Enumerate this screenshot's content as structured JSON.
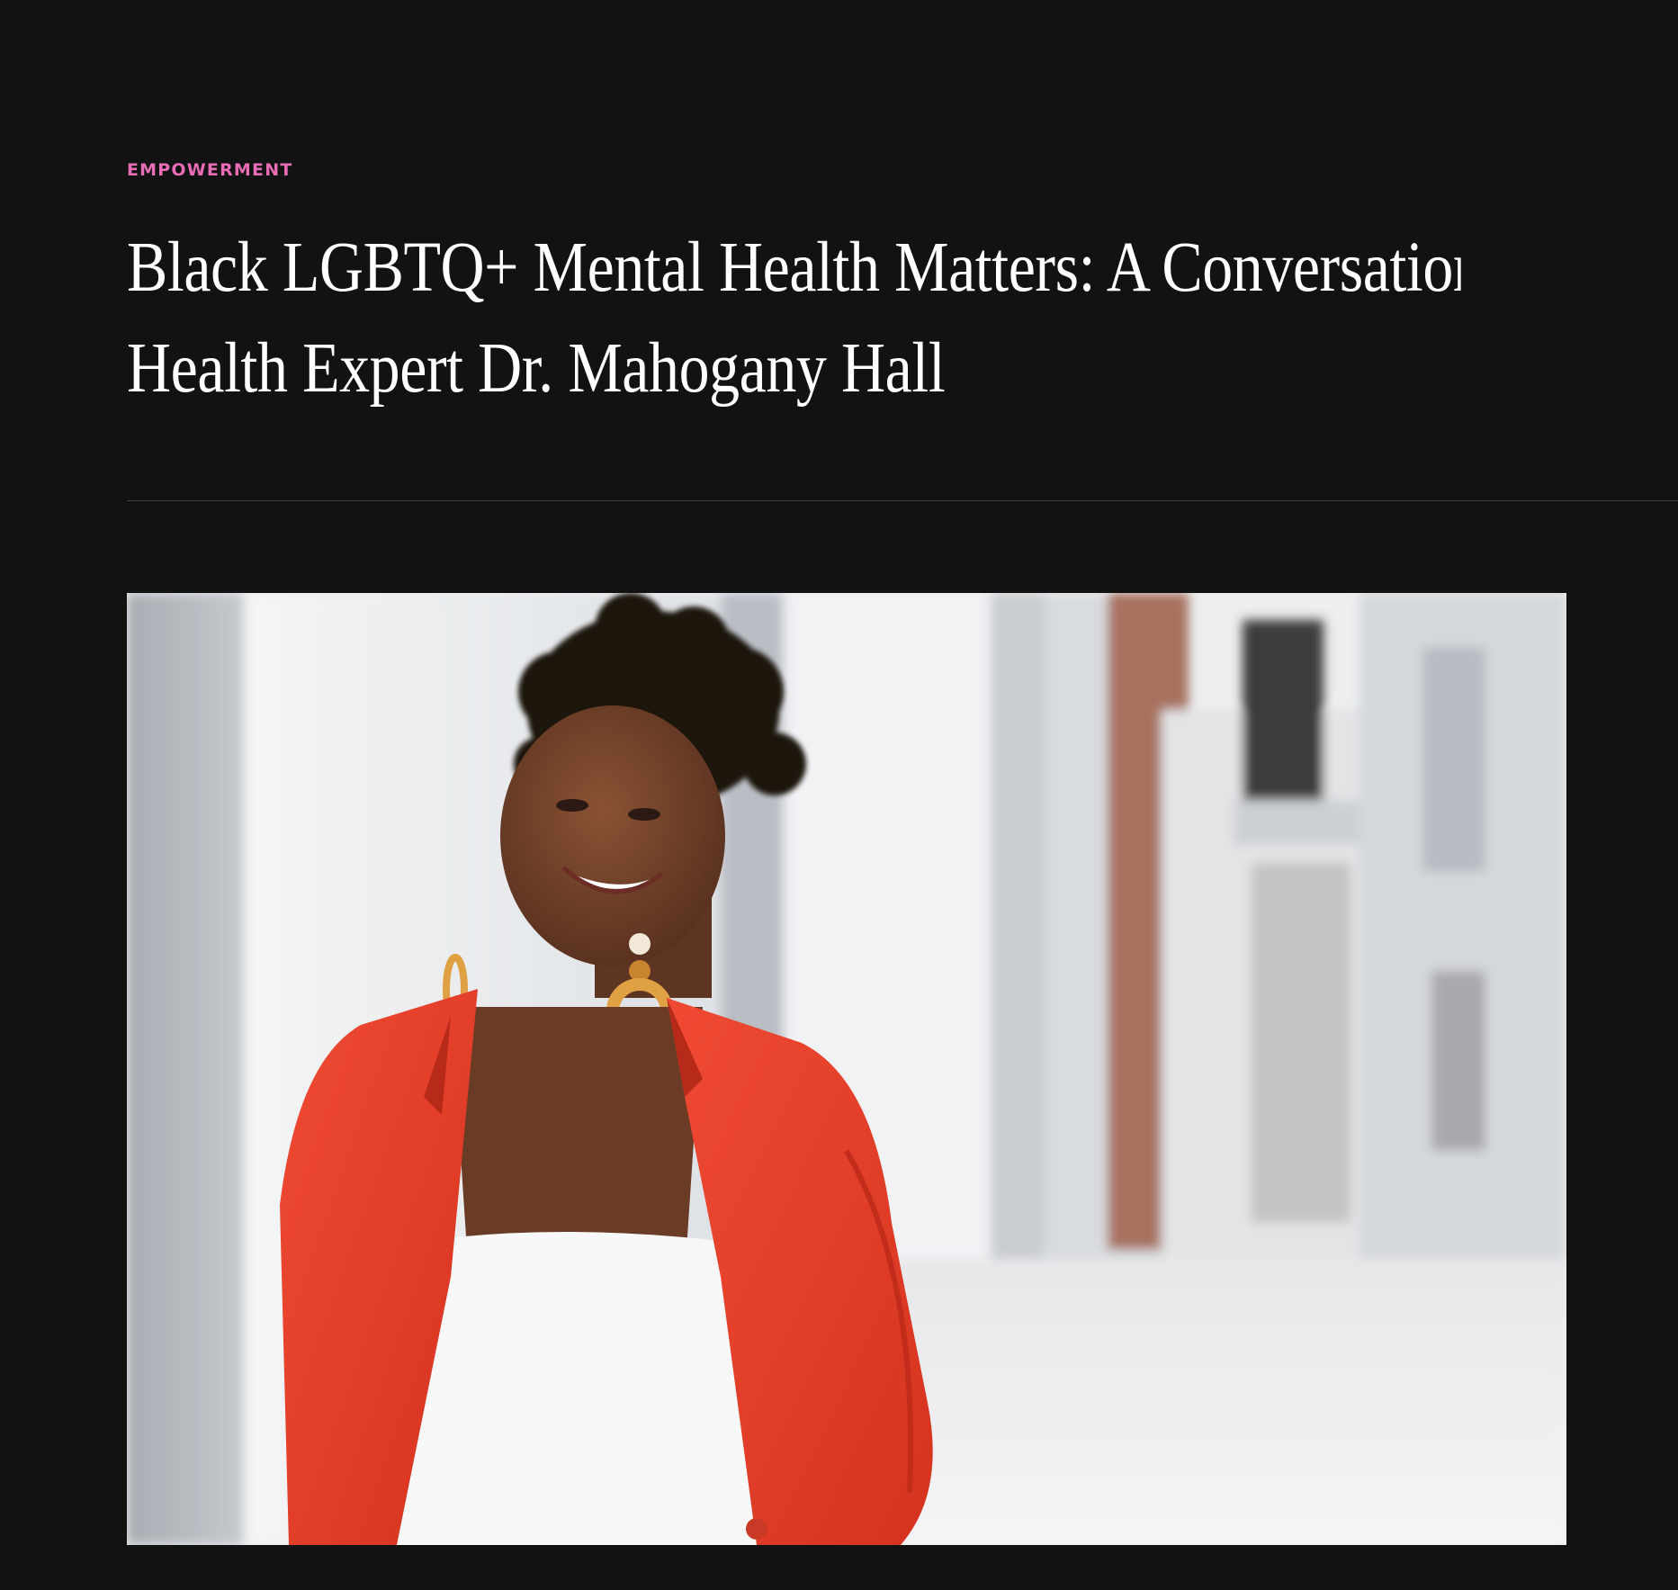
{
  "article": {
    "category": "EMPOWERMENT",
    "title_line_1": "Black LGBTQ+ Mental Health Matters: A Conversation with Mental",
    "title_line_2": "Health Expert Dr. Mahogany Hall"
  },
  "hero_image": {
    "alt": "Portrait of Dr. Mahogany Hall in a red blazer leaning against a white wall"
  },
  "colors": {
    "background": "#121212",
    "category": "#e96cb7",
    "title": "#ffffff",
    "divider": "#3e3e3e",
    "blazer": "#ea3f2c"
  }
}
